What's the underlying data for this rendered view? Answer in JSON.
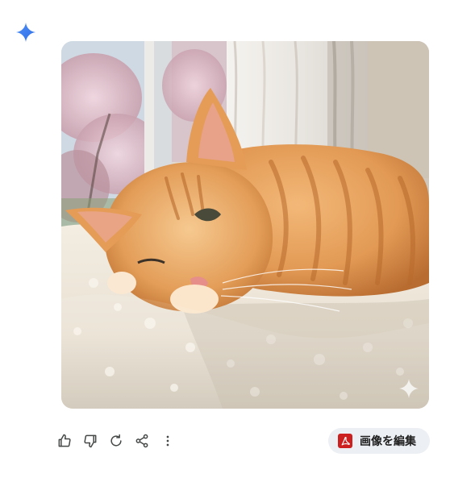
{
  "response": {
    "image_alt": "",
    "edit_button_label": "画像を編集"
  },
  "icons": {
    "logo": "sparkle-icon",
    "watermark": "sparkle-watermark-icon",
    "thumbs_up": "thumbs-up-icon",
    "thumbs_down": "thumbs-down-icon",
    "regenerate": "refresh-icon",
    "share": "share-icon",
    "more": "more-vert-icon",
    "edit": "pdf-icon"
  },
  "colors": {
    "accent_blue": "#4a86f7",
    "edit_button_bg": "#eceff3",
    "pdf_red": "#cc1f1f"
  }
}
